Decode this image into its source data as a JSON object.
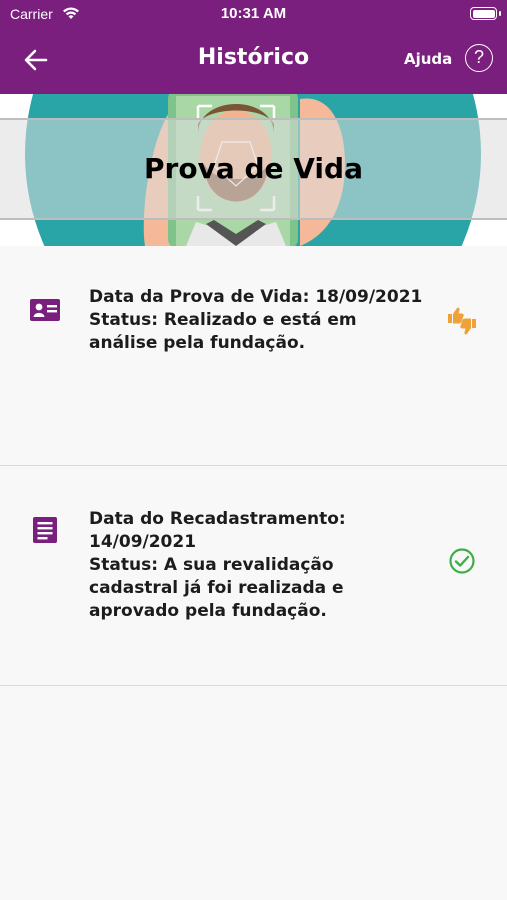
{
  "status_bar": {
    "carrier": "Carrier",
    "time": "10:31 AM"
  },
  "nav": {
    "title": "Histórico",
    "help_label": "Ajuda",
    "help_glyph": "?"
  },
  "banner": {
    "title": "Prova de Vida"
  },
  "items": [
    {
      "icon": "id-card-icon",
      "line1": "Data da Prova de Vida: 18/09/2021",
      "line2": "Status: Realizado e está em",
      "line3": "análise pela fundação.",
      "status_icon": "thumbs-up-down-icon",
      "status_color": "#f0a23a"
    },
    {
      "icon": "document-icon",
      "line1": "Data do Recadastramento:",
      "line2": "14/09/2021",
      "line3": "Status: A sua revalidação",
      "line4": "cadastral já foi realizada e",
      "line5": "aprovado pela fundação.",
      "status_icon": "check-circle-icon",
      "status_color": "#3fae48"
    }
  ],
  "colors": {
    "primary": "#7a1f7e",
    "banner_teal": "#1fa3a3",
    "icon_purple": "#7a1f7e"
  }
}
